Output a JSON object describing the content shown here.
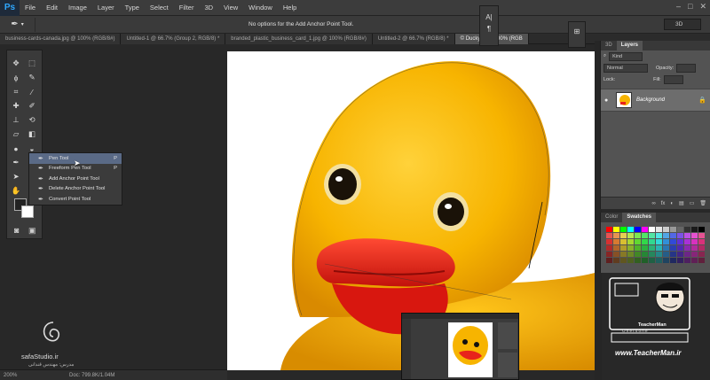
{
  "app": {
    "logo": "Ps"
  },
  "menu": [
    "File",
    "Edit",
    "Image",
    "Layer",
    "Type",
    "Select",
    "Filter",
    "3D",
    "View",
    "Window",
    "Help"
  ],
  "window_controls": [
    "–",
    "□",
    "✕"
  ],
  "options_bar": {
    "message": "No options for the Add Anchor Point Tool.",
    "workspace": "3D"
  },
  "mini_panels": {
    "char_icon": "A|",
    "para_icon": "¶",
    "icon2": "⊞"
  },
  "tabs": [
    {
      "label": "business-cards-canada.jpg @ 100% (RGB/8#)",
      "active": false
    },
    {
      "label": "Untitled-1 @ 66.7% (Group 2, RGB/8) *",
      "active": false
    },
    {
      "label": "branded_plastic_business_card_1.jpg @ 100% (RGB/8#)",
      "active": false
    },
    {
      "label": "Untitled-2 @ 66.7% (RGB/8) *",
      "active": false
    },
    {
      "label": "© Ducky.tif @ 100% (RGB",
      "active": true
    }
  ],
  "tools": [
    {
      "name": "move-tool-icon",
      "glyph": "✥"
    },
    {
      "name": "marquee-tool-icon",
      "glyph": "⬚"
    },
    {
      "name": "lasso-tool-icon",
      "glyph": "ϕ"
    },
    {
      "name": "magic-wand-tool-icon",
      "glyph": "✎"
    },
    {
      "name": "crop-tool-icon",
      "glyph": "⌗"
    },
    {
      "name": "eyedropper-tool-icon",
      "glyph": "⁄"
    },
    {
      "name": "spot-heal-tool-icon",
      "glyph": "✚"
    },
    {
      "name": "brush-tool-icon",
      "glyph": "✐"
    },
    {
      "name": "stamp-tool-icon",
      "glyph": "⊥"
    },
    {
      "name": "history-brush-tool-icon",
      "glyph": "⟲"
    },
    {
      "name": "eraser-tool-icon",
      "glyph": "▱"
    },
    {
      "name": "gradient-tool-icon",
      "glyph": "◧"
    },
    {
      "name": "blur-tool-icon",
      "glyph": "●"
    },
    {
      "name": "dodge-tool-icon",
      "glyph": "◒"
    },
    {
      "name": "pen-tool-icon",
      "glyph": "✒"
    },
    {
      "name": "type-tool-icon",
      "glyph": "T"
    },
    {
      "name": "path-select-tool-icon",
      "glyph": "➤"
    },
    {
      "name": "shape-tool-icon",
      "glyph": "▭"
    },
    {
      "name": "hand-tool-icon",
      "glyph": "✋"
    },
    {
      "name": "zoom-tool-icon",
      "glyph": "⚲"
    }
  ],
  "toolbar_extra": {
    "quickmask": "◙",
    "screenmode": "▣"
  },
  "flyout": [
    {
      "label": "Pen Tool",
      "key": "P",
      "selected": true
    },
    {
      "label": "Freeform Pen Tool",
      "key": "P",
      "selected": false
    },
    {
      "label": "Add Anchor Point Tool",
      "key": "",
      "selected": false
    },
    {
      "label": "Delete Anchor Point Tool",
      "key": "",
      "selected": false
    },
    {
      "label": "Convert Point Tool",
      "key": "",
      "selected": false
    }
  ],
  "flyout_pen_glyph": "✒",
  "layers_panel": {
    "tabs": [
      "3D",
      "Layers"
    ],
    "kind_label": "Kind",
    "mode": "Normal",
    "opacity_label": "Opacity:",
    "lock_label": "Lock:",
    "fill_label": "Fill:",
    "layer_name": "Background",
    "eye": "●",
    "lock_icon": "🔒",
    "bottom_icons": [
      "∞",
      "fx",
      "◐",
      "▤",
      "▭",
      "🗑"
    ]
  },
  "swatches_panel": {
    "tabs": [
      "Color",
      "Swatches"
    ]
  },
  "status": {
    "zoom": "200%",
    "doc": "Doc: 799.8K/1.04M"
  },
  "watermark_left": {
    "brand": "safaStudio.ir",
    "sub": "مدرس: مهندس قندانی"
  },
  "watermark_right": {
    "url": "www.TeacherMan.ir",
    "tm": "TeacherMan",
    "onet": "O n e   t o   o n e"
  },
  "colors": {
    "accent": "#2fa7ff",
    "duck": "#f7b400",
    "beak": "#e8231b",
    "selection": "#5a6a86"
  }
}
